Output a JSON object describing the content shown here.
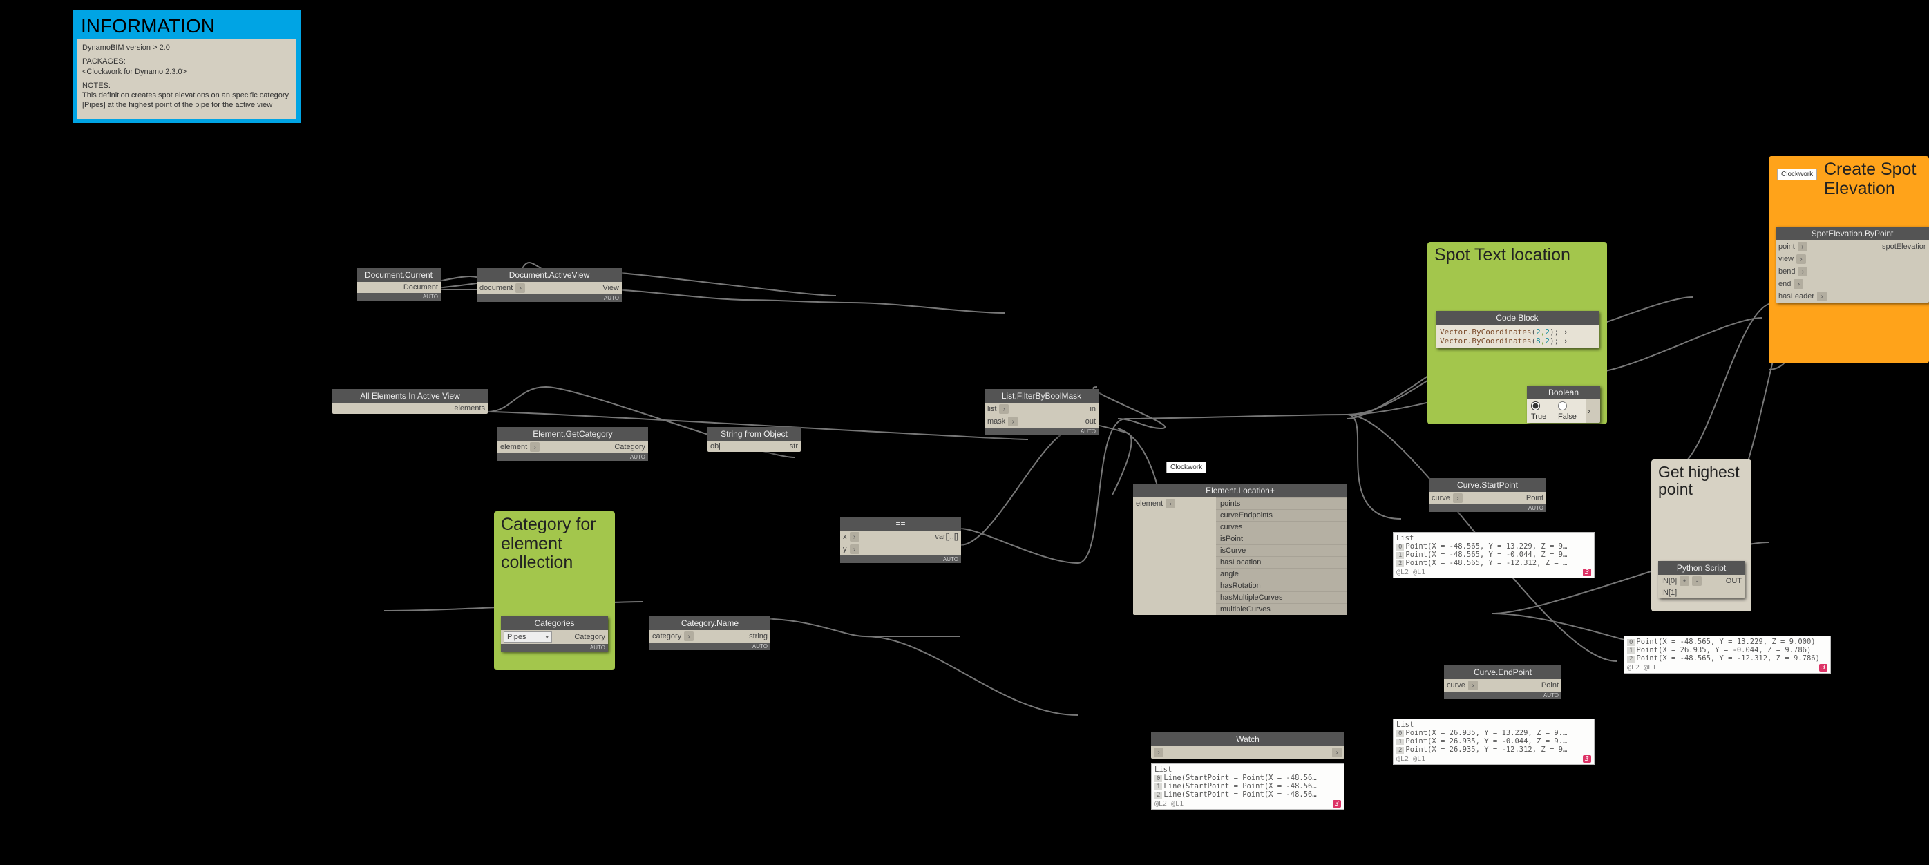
{
  "info": {
    "title": "INFORMATION",
    "version": "DynamoBIM version > 2.0",
    "packages_label": "PACKAGES:",
    "packages": "<Clockwork for Dynamo 2.3.0>",
    "notes_label": "NOTES:",
    "notes": "This definition creates spot elevations on an specific category [Pipes] at the highest point of the pipe for the active view"
  },
  "groups": {
    "category": {
      "title": "Category for element collection"
    },
    "spot_text": {
      "title": "Spot Text location"
    },
    "create_spot": {
      "title": "Create Spot Elevation"
    },
    "highest": {
      "title": "Get highest point"
    }
  },
  "clockwork_tag": "Clockwork",
  "lacing": "AUTO",
  "nodes": {
    "doc_current": {
      "title": "Document.Current",
      "out": "Document"
    },
    "doc_activeview": {
      "title": "Document.ActiveView",
      "in": "document",
      "out": "View"
    },
    "all_elems": {
      "title": "All Elements In Active View",
      "out": "elements"
    },
    "get_category": {
      "title": "Element.GetCategory",
      "in": "element",
      "out": "Category"
    },
    "string_from": {
      "title": "String from Object",
      "in": "obj",
      "out": "str"
    },
    "equals": {
      "title": "==",
      "in_x": "x",
      "in_y": "y",
      "out": "var[]..[]"
    },
    "filter_mask": {
      "title": "List.FilterByBoolMask",
      "in_list": "list",
      "in_mask": "mask",
      "out_in": "in",
      "out_out": "out"
    },
    "categories": {
      "title": "Categories",
      "selected": "Pipes",
      "out": "Category"
    },
    "category_name": {
      "title": "Category.Name",
      "in": "category",
      "out": "string"
    },
    "element_loc": {
      "title": "Element.Location+",
      "in": "element",
      "outs": [
        "points",
        "curveEndpoints",
        "curves",
        "isPoint",
        "isCurve",
        "hasLocation",
        "angle",
        "hasRotation",
        "hasMultipleCurves",
        "multipleCurves"
      ]
    },
    "curve_start": {
      "title": "Curve.StartPoint",
      "in": "curve",
      "out": "Point"
    },
    "curve_end": {
      "title": "Curve.EndPoint",
      "in": "curve",
      "out": "Point"
    },
    "code_block": {
      "title": "Code Block"
    },
    "boolean": {
      "title": "Boolean",
      "true": "True",
      "false": "False"
    },
    "python": {
      "title": "Python Script",
      "in0": "IN[0]",
      "in1": "IN[1]",
      "out": "OUT",
      "plus": "+",
      "minus": "-"
    },
    "spot_elev": {
      "title": "SpotElevation.ByPoint",
      "ins": [
        "point",
        "view",
        "bend",
        "end",
        "hasLeader"
      ],
      "out": "spotElevation"
    },
    "watch": {
      "title": "Watch"
    }
  },
  "code_lines": [
    {
      "fn": "Vector.ByCoordinates",
      "args": [
        "2",
        "2"
      ]
    },
    {
      "fn": "Vector.ByCoordinates",
      "args": [
        "8",
        "2"
      ]
    }
  ],
  "watch_lines": {
    "label": "List",
    "lines": [
      "Line(StartPoint = Point(X = -48.56…",
      "Line(StartPoint = Point(X = -48.56…",
      "Line(StartPoint = Point(X = -48.56…"
    ],
    "levels": "@L2 @L1",
    "count": "3"
  },
  "preview_start": {
    "label": "List",
    "lines": [
      "Point(X = -48.565, Y = 13.229, Z = 9…",
      "Point(X = -48.565, Y = -0.044, Z = 9…",
      "Point(X = -48.565, Y = -12.312, Z = …"
    ],
    "levels": "@L2 @L1",
    "count": "3"
  },
  "preview_end": {
    "label": "List",
    "lines": [
      "Point(X = 26.935, Y = 13.229, Z = 9.…",
      "Point(X = 26.935, Y = -0.044, Z = 9.…",
      "Point(X = 26.935, Y = -12.312, Z = 9…"
    ],
    "levels": "@L2 @L1",
    "count": "3"
  },
  "preview_python": {
    "lines": [
      "Point(X = -48.565, Y = 13.229, Z = 9.000)",
      "Point(X = 26.935, Y = -0.044, Z = 9.786)",
      "Point(X = -48.565, Y = -12.312, Z = 9.786)"
    ],
    "levels": "@L2 @L1",
    "count": "3"
  }
}
